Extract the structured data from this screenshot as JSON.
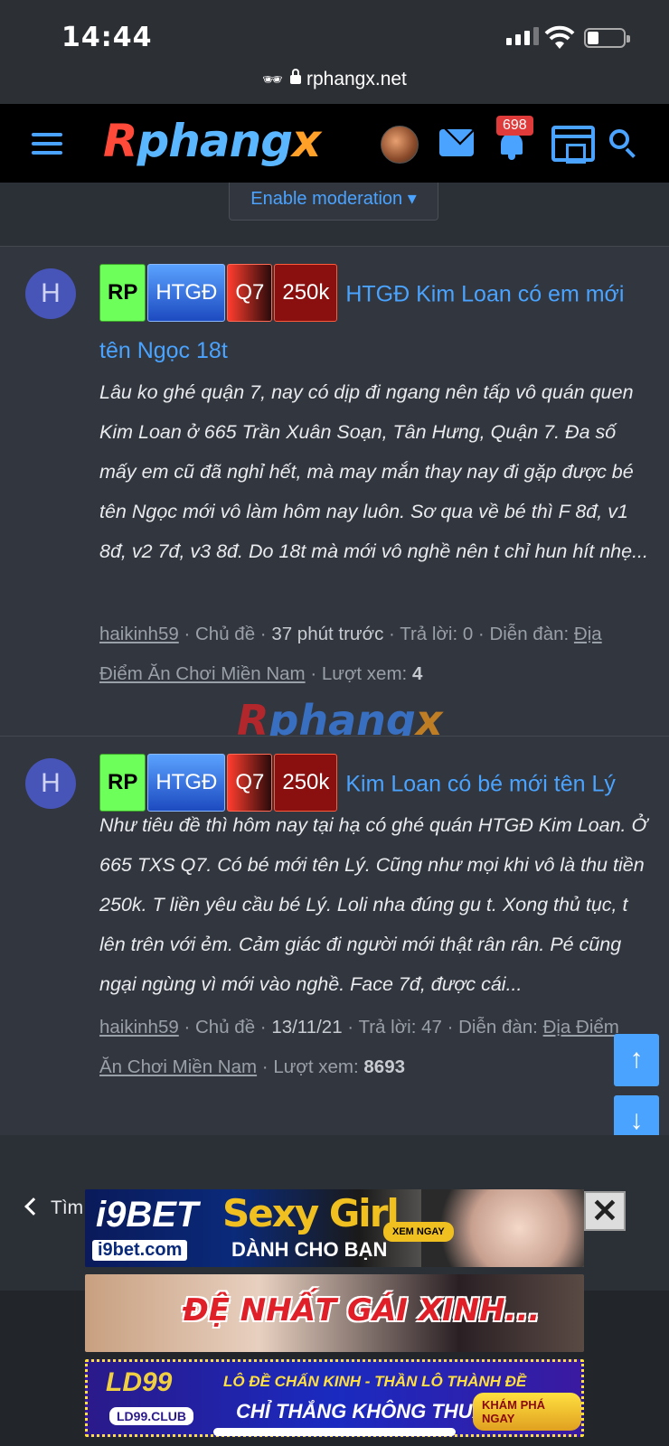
{
  "status": {
    "time": "14:44",
    "url": "rphangx.net"
  },
  "nav": {
    "logo_r": "R",
    "logo_p": "phang",
    "logo_x": "x",
    "notification_count": "698"
  },
  "moderation": {
    "label": "Enable moderation ▾"
  },
  "threads": [
    {
      "avatar": "H",
      "tags": [
        "RP",
        "HTGĐ",
        "Q7",
        "250k"
      ],
      "title": "HTGĐ Kim Loan có em mới tên Ngọc 18t",
      "excerpt": "Lâu ko ghé quận 7, nay có dịp đi ngang nên tấp vô quán quen Kim Loan ở 665 Trần Xuân Soạn, Tân Hưng, Quận 7. Đa số mấy em cũ đã nghỉ hết, mà may mắn thay nay đi gặp được bé tên Ngọc mới vô làm hôm nay luôn. Sơ qua về bé thì F 8đ, v1 8đ, v2 7đ, v3 8đ. Do 18t mà mới vô nghề nên t chỉ hun hít nhẹ...",
      "author": "haikinh59",
      "role": "Chủ đề",
      "time": "37 phút trước",
      "replies_label": "Trả lời: 0",
      "forum_label": "Diễn đàn:",
      "forum": "Địa Điểm Ăn Chơi Miền Nam",
      "views_label": "Lượt xem:",
      "views": "4"
    },
    {
      "avatar": "H",
      "tags": [
        "RP",
        "HTGĐ",
        "Q7",
        "250k"
      ],
      "title": "Kim Loan có bé mới tên Lý",
      "excerpt": "Như tiêu đề thì hôm nay tại hạ có ghé quán HTGĐ Kim Loan. Ở 665 TXS Q7. Có bé mới tên Lý. Cũng như mọi khi vô là thu tiền 250k. T liền yêu cầu bé Lý. Loli nha đúng gu t. Xong thủ tục, t lên trên với ẻm. Cảm giác đi người mới thật rân rân. Pé cũng ngại ngùng vì mới vào nghề. Face 7đ, được cái...",
      "author": "haikinh59",
      "role": "Chủ đề",
      "time": "13/11/21",
      "replies_label": "Trả lời: 47",
      "forum_label": "Diễn đàn:",
      "forum": "Địa Điểm Ăn Chơi Miền Nam",
      "views_label": "Lượt xem:",
      "views": "8693"
    }
  ],
  "back_link": "Tìm",
  "ads": {
    "ad1": {
      "brand": "i9BET",
      "site": "i9bet.com",
      "headline": "Sexy Girl",
      "sub": "DÀNH CHO BẠN",
      "cta": "XEM NGAY"
    },
    "ad2": {
      "headline": "ĐỆ NHẤT GÁI XINH..."
    },
    "ad3": {
      "brand": "LD99",
      "site": "LD99.CLUB",
      "line1": "LÔ ĐỀ CHẤN KINH - THẦN LÔ THÀNH ĐỀ",
      "line2": "CHỈ THẮNG KHÔNG THUA",
      "cta": "KHÁM PHÁ NGAY"
    }
  },
  "colors": {
    "accent": "#4aa3ff",
    "background": "#2b2f36",
    "card": "#32363e",
    "badge": "#e03b3b"
  }
}
